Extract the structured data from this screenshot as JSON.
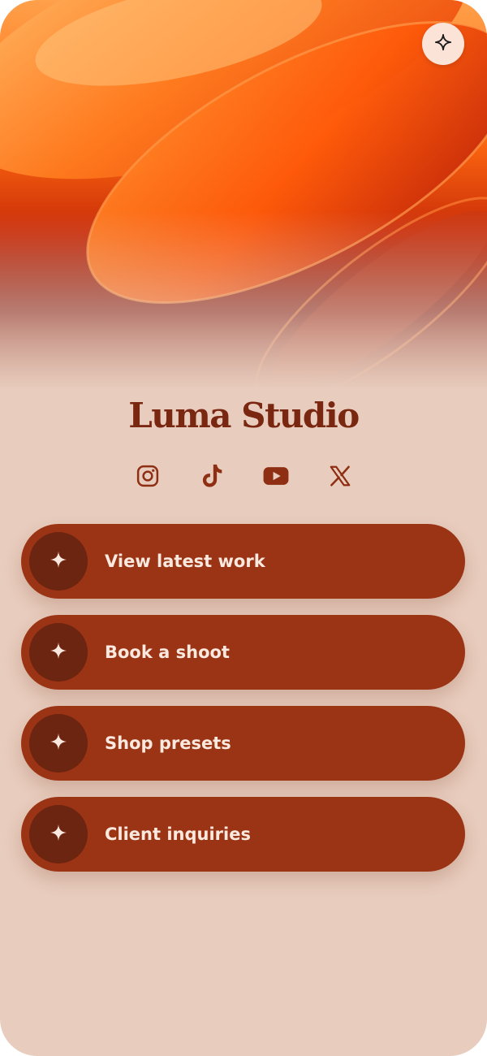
{
  "profile": {
    "name": "Luma Studio"
  },
  "top_action": {
    "icon": "sparkle-icon"
  },
  "socials": [
    {
      "name": "instagram",
      "icon": "instagram-icon"
    },
    {
      "name": "tiktok",
      "icon": "tiktok-icon"
    },
    {
      "name": "youtube",
      "icon": "youtube-icon"
    },
    {
      "name": "x",
      "icon": "x-icon"
    }
  ],
  "links": [
    {
      "label": "View latest work",
      "icon": "sparkle-icon"
    },
    {
      "label": "Book a shoot",
      "icon": "sparkle-icon"
    },
    {
      "label": "Shop presets",
      "icon": "sparkle-icon"
    },
    {
      "label": "Client inquiries",
      "icon": "sparkle-icon"
    }
  ],
  "colors": {
    "background": "#e8ccbd",
    "button": "#9a3414",
    "button_icon_bg": "#6c2510",
    "title": "#7a2711",
    "accent_orange": "#ff6a10"
  }
}
